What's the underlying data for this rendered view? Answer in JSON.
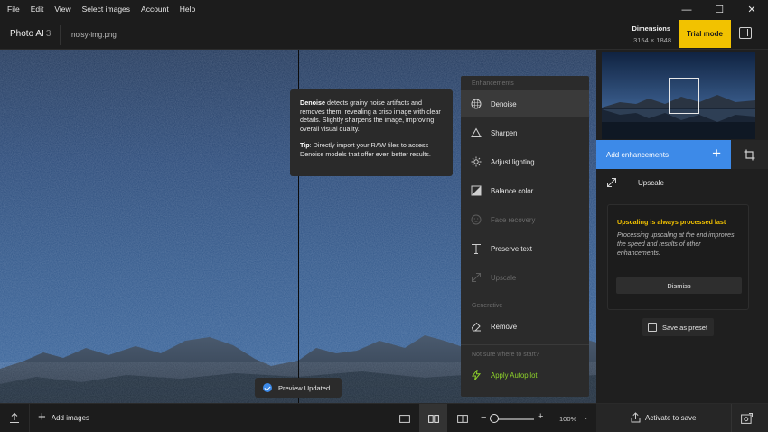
{
  "menu": [
    "File",
    "Edit",
    "View",
    "Select images",
    "Account",
    "Help"
  ],
  "window_controls": {
    "minimize": "—",
    "maximize": "☐",
    "close": "✕"
  },
  "header": {
    "app_name": "Photo AI",
    "app_version": "3",
    "file_name": "noisy-img.png",
    "dimensions_label": "Dimensions",
    "dimensions_value": "3154 × 1848",
    "trial_button": "Trial mode",
    "accent_color": "#f2c200"
  },
  "tooltip": {
    "title": "Denoise",
    "body": " detects grainy noise artifacts and removes them, revealing a crisp image with clear details. Slightly sharpens the image, improving overall visual quality.",
    "tip_label": "Tip",
    "tip_body": ": Directly import your RAW files to access Denoise models that offer even better results."
  },
  "enhancements_menu": {
    "section_enhancements": "Enhancements",
    "items": [
      {
        "label": "Denoise",
        "icon": "denoise-icon",
        "state": "active"
      },
      {
        "label": "Sharpen",
        "icon": "sharpen-icon",
        "state": "normal"
      },
      {
        "label": "Adjust lighting",
        "icon": "lighting-icon",
        "state": "normal"
      },
      {
        "label": "Balance color",
        "icon": "balance-color-icon",
        "state": "normal"
      },
      {
        "label": "Face recovery",
        "icon": "face-icon",
        "state": "disabled"
      },
      {
        "label": "Preserve text",
        "icon": "text-icon",
        "state": "normal"
      },
      {
        "label": "Upscale",
        "icon": "upscale-icon",
        "state": "disabled"
      }
    ],
    "section_generative": "Generative",
    "generative_items": [
      {
        "label": "Remove",
        "icon": "eraser-icon",
        "state": "normal"
      }
    ],
    "section_help": "Not sure where to start?",
    "autopilot_label": "Apply Autopilot",
    "autopilot_color": "#8ed32a"
  },
  "right_panel": {
    "add_enhancements": "Add enhancements",
    "add_color": "#3d8ae8",
    "upscale_label": "Upscale",
    "note_title": "Upscaling is always processed last",
    "note_body": "Processing upscaling at the end improves the speed and results of other enhancements.",
    "dismiss": "Dismiss",
    "save_preset": "Save as preset"
  },
  "toast": {
    "label": "Preview Updated"
  },
  "bottom_bar": {
    "add_images": "Add images",
    "zoom": "100%",
    "activate": "Activate to save"
  }
}
